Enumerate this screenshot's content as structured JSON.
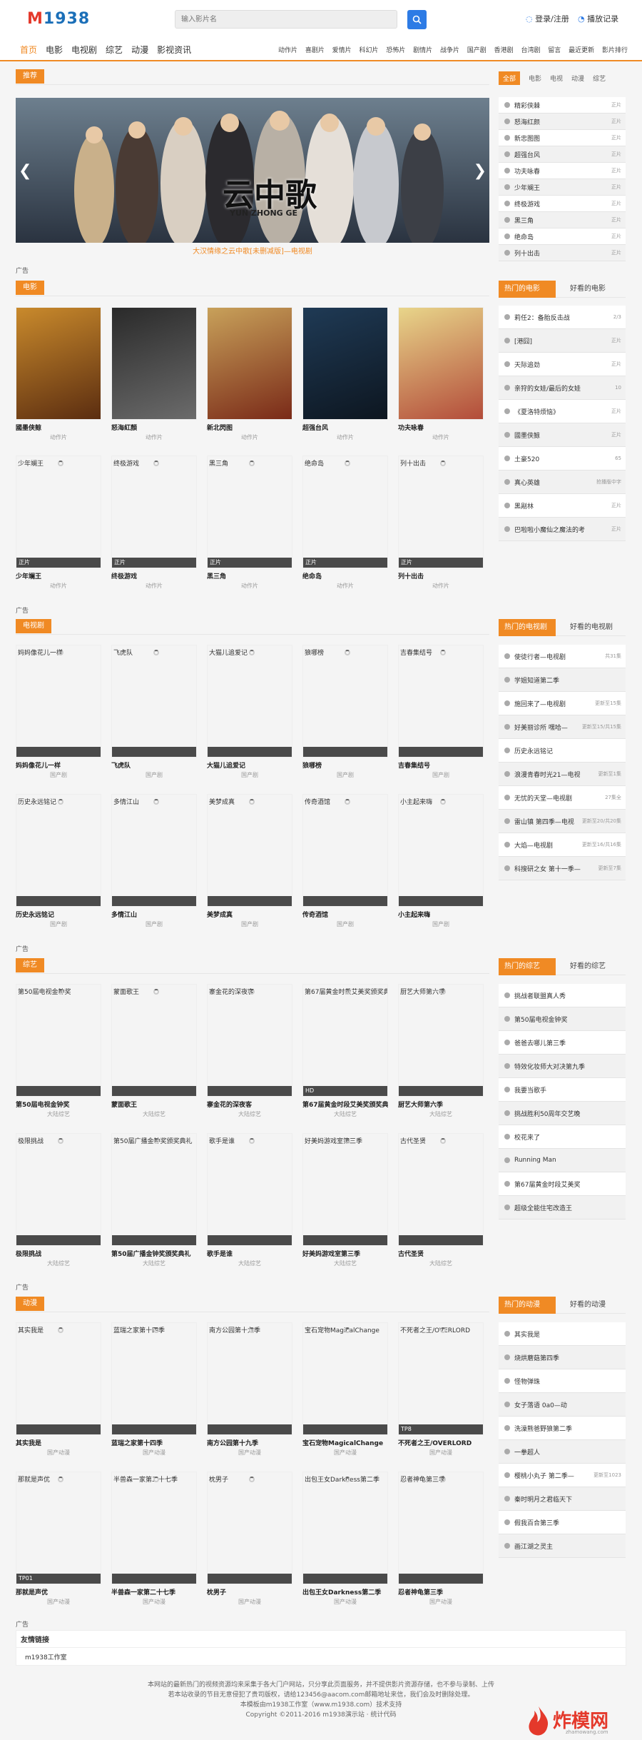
{
  "header": {
    "logo": "M1938",
    "logo_m": "M",
    "logo_rest": "1938",
    "search_placeholder": "输入影片名",
    "login": "登录/注册",
    "history": "播放记录"
  },
  "nav": {
    "main": [
      "首页",
      "电影",
      "电视剧",
      "综艺",
      "动漫",
      "影视资讯"
    ],
    "sub": [
      "动作片",
      "喜剧片",
      "爱情片",
      "科幻片",
      "恐怖片",
      "剧情片",
      "战争片",
      "国产剧",
      "香港剧",
      "台湾剧",
      "留言",
      "最近更新",
      "影片排行"
    ]
  },
  "recommend": {
    "label": "推荐",
    "caption": "大汉情缘之云中歌[未删减版]—电视剧",
    "banner_text": "云中歌",
    "banner_sub": "YUN ZHONG GE",
    "tabs": [
      "全部",
      "电影",
      "电视",
      "动漫",
      "综艺"
    ],
    "items": [
      {
        "t": "精彩侠棘",
        "r": "正片"
      },
      {
        "t": "怒海红颜",
        "r": "正片"
      },
      {
        "t": "新忠图图",
        "r": "正片"
      },
      {
        "t": "超强台风",
        "r": "正片"
      },
      {
        "t": "功夫咏春",
        "r": "正片"
      },
      {
        "t": "少年斓王",
        "r": "正片"
      },
      {
        "t": "终极游戏",
        "r": "正片"
      },
      {
        "t": "黑三角",
        "r": "正片"
      },
      {
        "t": "绝命岛",
        "r": "正片"
      },
      {
        "t": "列十出击",
        "r": "正片"
      }
    ]
  },
  "ad_label": "广告",
  "movies": {
    "label": "电影",
    "hot_tab": "热门的电影",
    "good_tab": "好看的电影",
    "row1": [
      {
        "t": "國墨侠鲸",
        "s": "动作片"
      },
      {
        "t": "怒海紅顏",
        "s": "动作片"
      },
      {
        "t": "新北閃图",
        "s": "动作片"
      },
      {
        "t": "超强台风",
        "s": "动作片"
      },
      {
        "t": "功夫咏春",
        "s": "动作片"
      }
    ],
    "row2": [
      {
        "tt": "少年斓王",
        "t": "少年斓王",
        "s": "动作片",
        "b": "正片"
      },
      {
        "tt": "终极游戏",
        "t": "终极游戏",
        "s": "动作片",
        "b": "正片"
      },
      {
        "tt": "黑三角",
        "t": "黑三角",
        "s": "动作片",
        "b": "正片"
      },
      {
        "tt": "绝命岛",
        "t": "绝命岛",
        "s": "动作片",
        "b": "正片"
      },
      {
        "tt": "列十出击",
        "t": "列十出击",
        "s": "动作片",
        "b": "正片"
      }
    ],
    "side": [
      {
        "t": "莉任2：备胎反击战",
        "r": "2/3"
      },
      {
        "t": "[港囧]",
        "r": "正片"
      },
      {
        "t": "天际追劲",
        "r": "正片"
      },
      {
        "t": "亲狩的女娃/最后的女娃",
        "r": "10"
      },
      {
        "t": "《夏洛特烦恼》",
        "r": "正片"
      },
      {
        "t": "國墨侠鲸",
        "r": "正片"
      },
      {
        "t": "土豪520",
        "r": "65"
      },
      {
        "t": "真心英雄",
        "r": "抢播版中字"
      },
      {
        "t": "黑剐林",
        "r": "正片"
      },
      {
        "t": "巴啦啦小魔仙之魔法的考",
        "r": "正片"
      }
    ]
  },
  "tv": {
    "label": "电视剧",
    "hot_tab": "热门的电视剧",
    "good_tab": "好看的电视剧",
    "row1": [
      {
        "t": "妈妈像花儿一样",
        "s": "国产剧"
      },
      {
        "t": "飞虎队",
        "s": "国产剧"
      },
      {
        "t": "大猫儿追爱记",
        "s": "国产剧"
      },
      {
        "t": "狼哪榜",
        "s": "国产剧"
      },
      {
        "t": "吉春集结号",
        "s": "国产剧"
      }
    ],
    "row2": [
      {
        "t": "历史永远铭记",
        "s": "国产剧"
      },
      {
        "t": "多情江山",
        "s": "国产剧"
      },
      {
        "t": "美梦成真",
        "s": "国产剧"
      },
      {
        "t": "传奇酒馆",
        "s": "国产剧"
      },
      {
        "t": "小主起来嗨",
        "s": "国产剧"
      }
    ],
    "side": [
      {
        "t": "使徒行者—电视剧",
        "r": "共31集"
      },
      {
        "t": "学姐知道第二季",
        "r": ""
      },
      {
        "t": "施回来了—电视剧",
        "r": "更新至15集"
      },
      {
        "t": "好美丽诊所 嘿哈—",
        "r": "更新至15/共15集"
      },
      {
        "t": "历史永远铭记",
        "r": ""
      },
      {
        "t": "浪漫青春时光21—电视",
        "r": "更新至1集"
      },
      {
        "t": "无忧的天堂—电视剧",
        "r": "27集全"
      },
      {
        "t": "雷山镇 第四季—电视",
        "r": "更新至20/共20集"
      },
      {
        "t": "大焰—电视剧",
        "r": "更新至16/共16集"
      },
      {
        "t": "科搜研之女 第十一季—",
        "r": "更新至7集"
      }
    ]
  },
  "variety": {
    "label": "综艺",
    "hot_tab": "热门的综艺",
    "good_tab": "好看的综艺",
    "row1": [
      {
        "t": "第50屆电视金钟奖",
        "s": "大陆综艺",
        "b": ""
      },
      {
        "t": "蒙面歌王",
        "s": "大陆综艺",
        "b": ""
      },
      {
        "t": "寨金花的深夜客",
        "s": "大陆综艺",
        "b": ""
      },
      {
        "t": "第67届黄金时段艾美奖颁奖典礼",
        "s": "大陆综艺",
        "b": "HD"
      },
      {
        "t": "厨艺大师第六季",
        "s": "大陆综艺",
        "b": ""
      }
    ],
    "row2": [
      {
        "t": "极限挑战",
        "s": "大陆综艺"
      },
      {
        "t": "第50届广播金钟奖颁奖典礼",
        "s": "大陆综艺"
      },
      {
        "t": "歌手是谁",
        "s": "大陆综艺"
      },
      {
        "t": "好美妈游戏室第三季",
        "s": "大陆综艺"
      },
      {
        "t": "古代圣贤",
        "s": "大陆综艺"
      }
    ],
    "side": [
      {
        "t": "挑战者联盟真人秀"
      },
      {
        "t": "第50届电视金钟奖"
      },
      {
        "t": "爸爸去哪儿第三季"
      },
      {
        "t": "特效化妆师大对决第九季"
      },
      {
        "t": "我要当歌手"
      },
      {
        "t": "挑战胜利50周年交艺晚"
      },
      {
        "t": "校花来了"
      },
      {
        "t": "Running Man"
      },
      {
        "t": "第67届黄金时段艾美奖"
      },
      {
        "t": "超级全能住宅改造王"
      }
    ]
  },
  "anime": {
    "label": "动漫",
    "hot_tab": "热门的动漫",
    "good_tab": "好看的动漫",
    "row1": [
      {
        "t": "其实我是",
        "s": "国产动漫",
        "b": ""
      },
      {
        "t": "蓝瑞之家第十四季",
        "s": "国产动漫",
        "b": ""
      },
      {
        "t": "南方公园第十九季",
        "s": "国产动漫",
        "b": ""
      },
      {
        "t": "宝石宠物MagicalChange",
        "s": "国产动漫",
        "b": ""
      },
      {
        "t": "不死者之王/OVERLORD",
        "s": "国产动漫",
        "b": "TP8"
      }
    ],
    "row2": [
      {
        "t": "那就是声优",
        "s": "国产动漫",
        "b": "TP01"
      },
      {
        "t": "半兽森一家第二十七季",
        "s": "国产动漫",
        "b": ""
      },
      {
        "t": "枕男子",
        "s": "国产动漫",
        "b": ""
      },
      {
        "t": "出包王女Darkness第二季",
        "s": "国产动漫",
        "b": ""
      },
      {
        "t": "忍者神龟第三季",
        "s": "国产动漫",
        "b": ""
      }
    ],
    "side": [
      {
        "t": "其实我是",
        "r": ""
      },
      {
        "t": "烧烘蘑菇第四季",
        "r": ""
      },
      {
        "t": "怪物弹珠",
        "r": ""
      },
      {
        "t": "女子落语 0a0—动",
        "r": ""
      },
      {
        "t": "洗澡熊爸野狼第二季",
        "r": ""
      },
      {
        "t": "一拳超人",
        "r": ""
      },
      {
        "t": "樱桃小丸子 第二季—",
        "r": "更新至1023"
      },
      {
        "t": "秦时明月之君临天下",
        "r": ""
      },
      {
        "t": "假我百合第三季",
        "r": ""
      },
      {
        "t": "画江湖之灵主",
        "r": ""
      }
    ]
  },
  "friend": {
    "title": "友情链接",
    "link": "m1938工作室"
  },
  "footer": {
    "l1": "本网站的最新热门的视频资源均来采集于各大门户网站，只分享此页面服务，并不提供影片资源存储，也不参与录制、上传",
    "l2": "若本站收录的节目无意侵犯了贵司版权，请给123456@aacom.com邮箱地址来信，我们会及时删除处理。",
    "l3": "本模板由m1938工作室（www.m1938.com）技术支持",
    "l4": "Copyright ©2011-2016 m1938演示站 · 统计代码"
  },
  "brand": {
    "name": "炸模网",
    "sub": "zhamowang.com"
  }
}
